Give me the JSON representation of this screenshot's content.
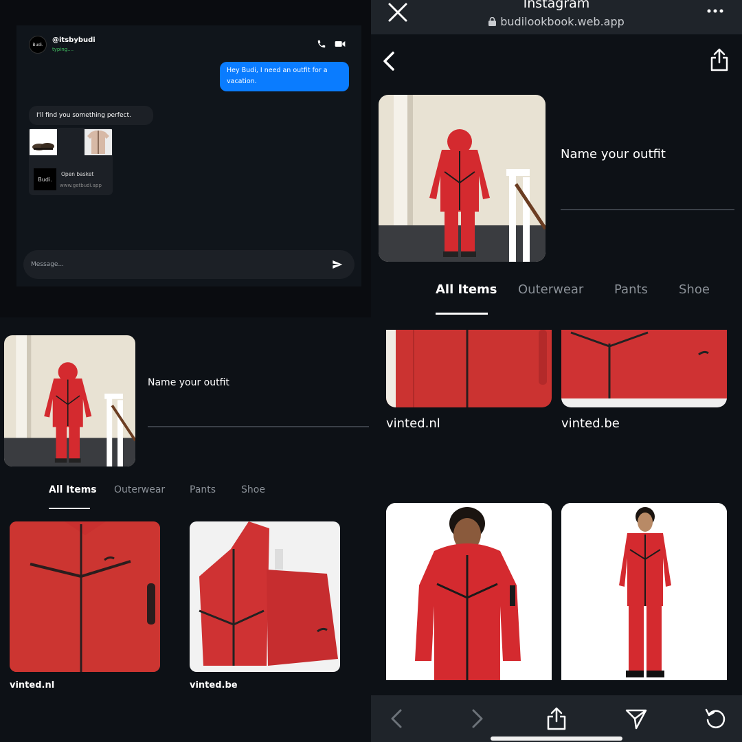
{
  "chat": {
    "avatar_text": "Budi.",
    "handle": "@itsbybudi",
    "status": "typing....",
    "outgoing_message": "Hey Budi, I need an outfit for a vacation.",
    "incoming_message": "I'll find you something perfect.",
    "basket": {
      "logo_text": "Budi.",
      "title": "Open basket",
      "url": "www.getbudi.app"
    },
    "input_placeholder": "Message...",
    "colors": {
      "outgoing_bubble": "#0a7cff",
      "status": "#43c463"
    }
  },
  "lookbook": {
    "outfit_name_placeholder": "Name your outfit",
    "tabs": [
      "All Items",
      "Outerwear",
      "Pants",
      "Shoe"
    ],
    "active_tab": "All Items",
    "items": [
      {
        "source": "vinted.nl"
      },
      {
        "source": "vinted.be"
      }
    ]
  },
  "browser": {
    "title": "Instagram",
    "url": "budilookbook.web.app",
    "outfit_name_placeholder": "Name your outfit",
    "tabs": [
      "All Items",
      "Outerwear",
      "Pants",
      "Shoe"
    ],
    "active_tab": "All Items",
    "items": [
      {
        "source": "vinted.nl"
      },
      {
        "source": "vinted.be"
      }
    ],
    "icons": [
      "close-icon",
      "lock-icon",
      "more-icon",
      "back-icon",
      "share-icon",
      "chevron-left-icon",
      "chevron-right-icon",
      "send-icon",
      "refresh-icon"
    ]
  },
  "palette": {
    "background": "#0d1116",
    "accent_red": "#d42a2f",
    "bar": "#1f242a"
  }
}
